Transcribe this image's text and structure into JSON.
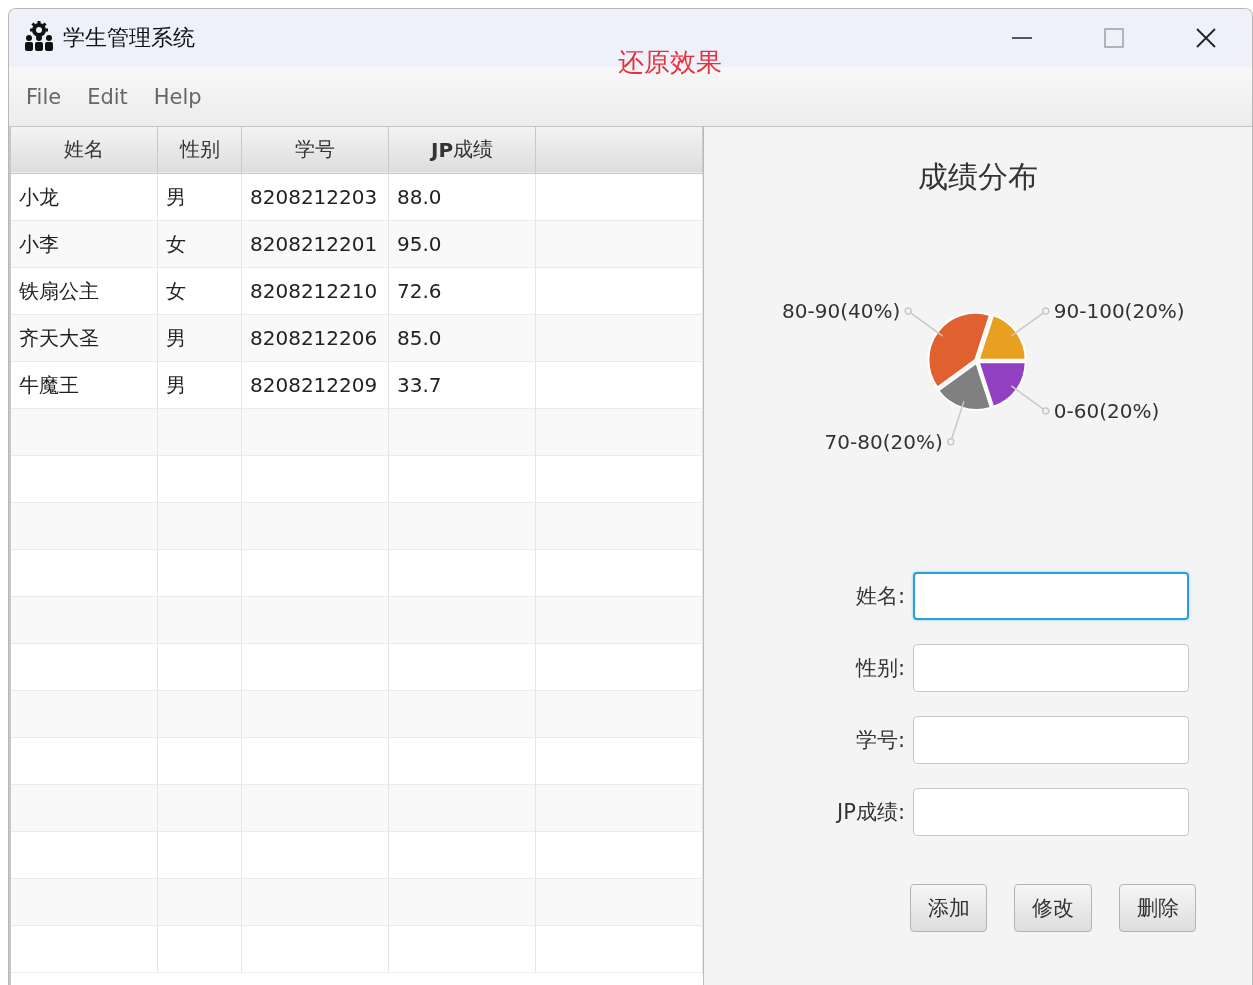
{
  "window": {
    "title": "学生管理系统"
  },
  "annotation": "还原效果",
  "menu": [
    "File",
    "Edit",
    "Help"
  ],
  "table": {
    "columns": [
      "姓名",
      "性别",
      "学号",
      "**JP**成绩"
    ],
    "rows": [
      [
        "小龙",
        "男",
        "8208212203",
        "88.0"
      ],
      [
        "小李",
        "女",
        "8208212201",
        "95.0"
      ],
      [
        "铁扇公主",
        "女",
        "8208212210",
        "72.6"
      ],
      [
        "齐天大圣",
        "男",
        "8208212206",
        "85.0"
      ],
      [
        "牛魔王",
        "男",
        "8208212209",
        "33.7"
      ]
    ]
  },
  "chart_panel": {
    "chart_data": {
      "type": "pie",
      "title": "成绩分布",
      "categories": [
        "90-100(20%)",
        "0-60(20%)",
        "70-80(20%)",
        "80-90(40%)"
      ],
      "values": [
        20,
        20,
        20,
        40
      ]
    }
  },
  "form": {
    "fields": [
      {
        "label": "姓名:",
        "focused": true
      },
      {
        "label": "性别:",
        "focused": false
      },
      {
        "label": "学号:",
        "focused": false
      },
      {
        "label": "JP成绩:",
        "focused": false
      }
    ],
    "buttons": [
      "添加",
      "修改",
      "删除"
    ]
  }
}
